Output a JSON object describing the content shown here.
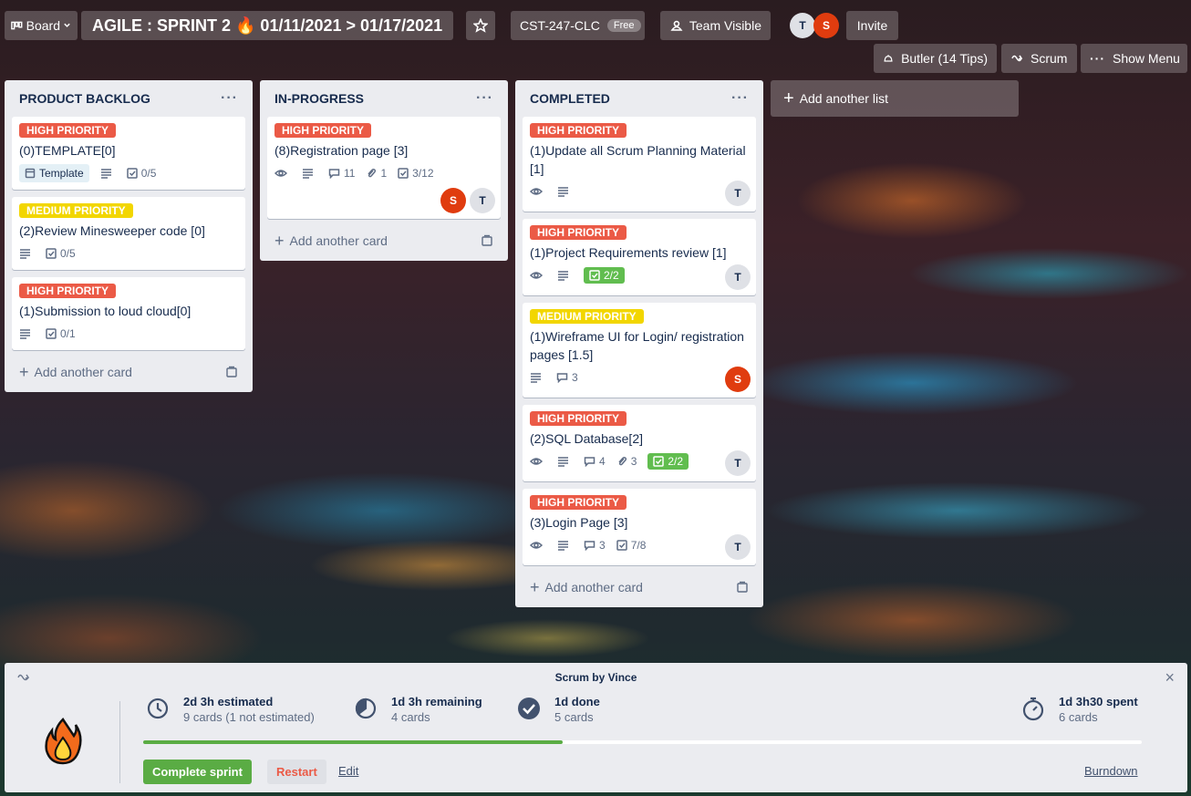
{
  "header": {
    "board_switcher": "Board",
    "board_title": "AGILE : SPRINT 2 🔥 01/11/2021 > 01/17/2021",
    "workspace": "CST-247-CLC",
    "workspace_badge": "Free",
    "visibility": "Team Visible",
    "members": [
      "T",
      "S"
    ],
    "invite": "Invite",
    "butler": "Butler (14 Tips)",
    "scrum": "Scrum",
    "show_menu": "Show Menu"
  },
  "lists": [
    {
      "title": "PRODUCT BACKLOG",
      "add_card": "Add another card",
      "cards": [
        {
          "label": "HIGH PRIORITY",
          "title": "(0)TEMPLATE[0]",
          "template": "Template",
          "checklist": "0/5"
        },
        {
          "label": "MEDIUM PRIORITY",
          "title": "(2)Review Minesweeper code [0]",
          "checklist": "0/5"
        },
        {
          "label": "HIGH PRIORITY",
          "title": "(1)Submission to loud cloud[0]",
          "checklist": "0/1"
        }
      ]
    },
    {
      "title": "IN-PROGRESS",
      "add_card": "Add another card",
      "cards": [
        {
          "label": "HIGH PRIORITY",
          "title": "(8)Registration page [3]",
          "comments": "11",
          "attachments": "1",
          "checklist": "3/12",
          "members": [
            "S",
            "T"
          ]
        }
      ]
    },
    {
      "title": "COMPLETED",
      "add_card": "Add another card",
      "cards": [
        {
          "label": "HIGH PRIORITY",
          "title": "(1)Update all Scrum Planning Material [1]",
          "members": [
            "T"
          ]
        },
        {
          "label": "HIGH PRIORITY",
          "title": "(1)Project Requirements review [1]",
          "checklist": "2/2",
          "members": [
            "T"
          ]
        },
        {
          "label": "MEDIUM PRIORITY",
          "title": "(1)Wireframe UI for Login/ registration pages [1.5]",
          "comments": "3",
          "members": [
            "S"
          ]
        },
        {
          "label": "HIGH PRIORITY",
          "title": "(2)SQL Database[2]",
          "comments": "4",
          "attachments": "3",
          "checklist": "2/2",
          "members": [
            "T"
          ]
        },
        {
          "label": "HIGH PRIORITY",
          "title": "(3)Login Page [3]",
          "comments": "3",
          "checklist": "7/8",
          "members": [
            "T"
          ]
        }
      ]
    }
  ],
  "add_list": "Add another list",
  "scrum_panel": {
    "title": "Scrum by Vince",
    "estimated": "2d 3h estimated",
    "estimated_sub": "9 cards (1 not estimated)",
    "remaining": "1d 3h remaining",
    "remaining_sub": "4 cards",
    "done": "1d done",
    "done_sub": "5 cards",
    "spent": "1d 3h30 spent",
    "spent_sub": "6 cards",
    "progress_fraction": 0.42,
    "complete_sprint": "Complete sprint",
    "restart": "Restart",
    "edit": "Edit",
    "burndown": "Burndown"
  },
  "colors": {
    "label_red": "#eb5a46",
    "label_yellow": "#f2d600",
    "complete_green": "#61bd4f",
    "avatar_s": "#e03c0f"
  }
}
